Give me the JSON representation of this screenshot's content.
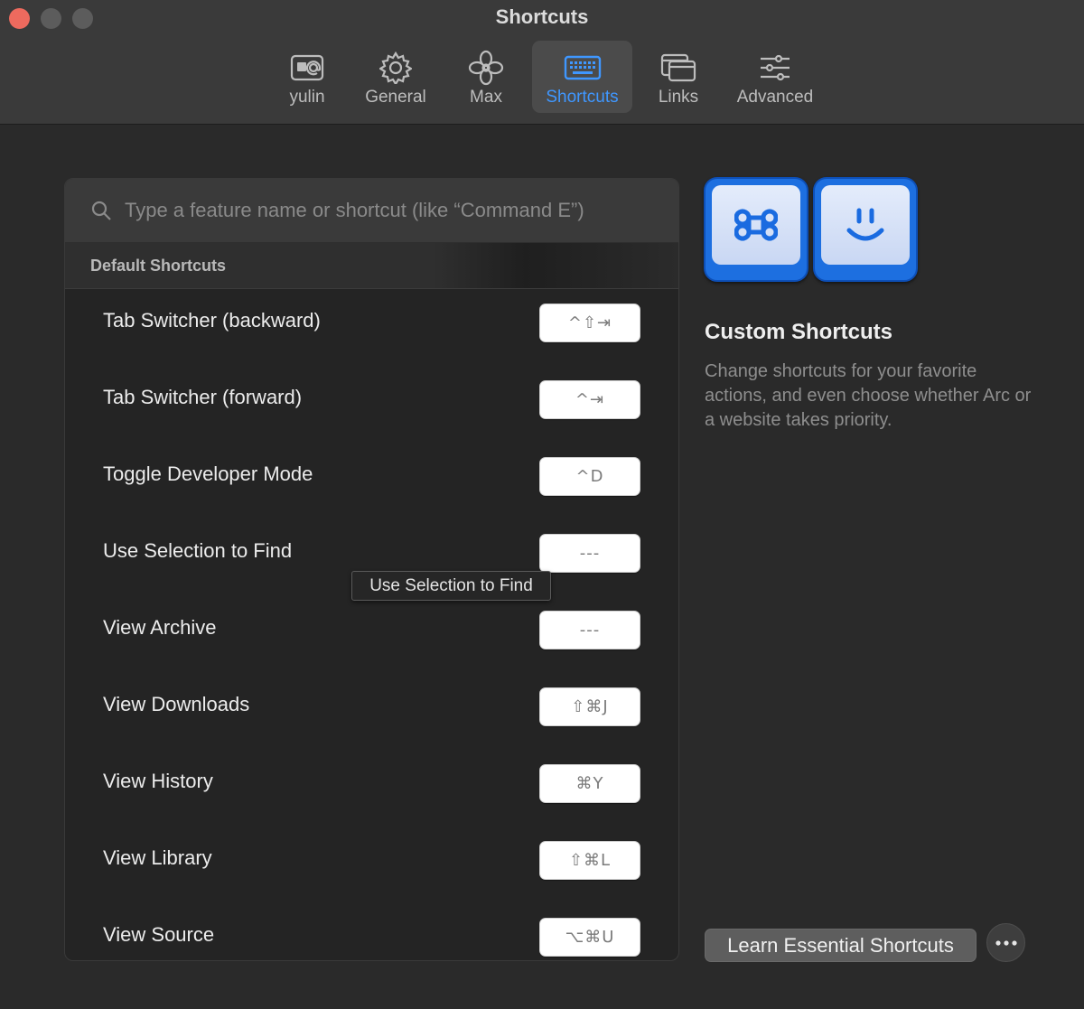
{
  "window": {
    "title": "Shortcuts",
    "traffic_lights": [
      "close",
      "minimize",
      "maximize"
    ]
  },
  "toolbar": {
    "tabs": [
      {
        "label": "yulin",
        "icon": "contact-card-icon",
        "active": false
      },
      {
        "label": "General",
        "icon": "gear-icon",
        "active": false
      },
      {
        "label": "Max",
        "icon": "max-flower-icon",
        "active": false
      },
      {
        "label": "Shortcuts",
        "icon": "keyboard-icon",
        "active": true
      },
      {
        "label": "Links",
        "icon": "windows-icon",
        "active": false
      },
      {
        "label": "Advanced",
        "icon": "sliders-icon",
        "active": false
      }
    ]
  },
  "search": {
    "placeholder": "Type a feature name or shortcut (like “Command E”)",
    "value": ""
  },
  "section": {
    "header": "Default Shortcuts"
  },
  "shortcuts": [
    {
      "label": "Tab Switcher (backward)",
      "keys": "^⇧⇥"
    },
    {
      "label": "Tab Switcher (forward)",
      "keys": "^⇥"
    },
    {
      "label": "Toggle Developer Mode",
      "keys": "^D"
    },
    {
      "label": "Use Selection to Find",
      "keys": "---"
    },
    {
      "label": "View Archive",
      "keys": "---"
    },
    {
      "label": "View Downloads",
      "keys": "⇧⌘J"
    },
    {
      "label": "View History",
      "keys": "⌘Y"
    },
    {
      "label": "View Library",
      "keys": "⇧⌘L"
    },
    {
      "label": "View Source",
      "keys": "⌥⌘U"
    }
  ],
  "tooltip": {
    "text": "Use Selection to Find"
  },
  "custom": {
    "title": "Custom Shortcuts",
    "description": "Change shortcuts for your favorite actions, and even choose whether Arc or a website takes priority.",
    "hero_icons": [
      "command-key-icon",
      "smiley-key-icon"
    ]
  },
  "footer": {
    "learn_label": "Learn Essential Shortcuts",
    "more_icon": "ellipsis-icon"
  },
  "colors": {
    "accent": "#3f97ff",
    "close_button": "#ed6a5e",
    "hero_key": "#1d6fe0"
  }
}
